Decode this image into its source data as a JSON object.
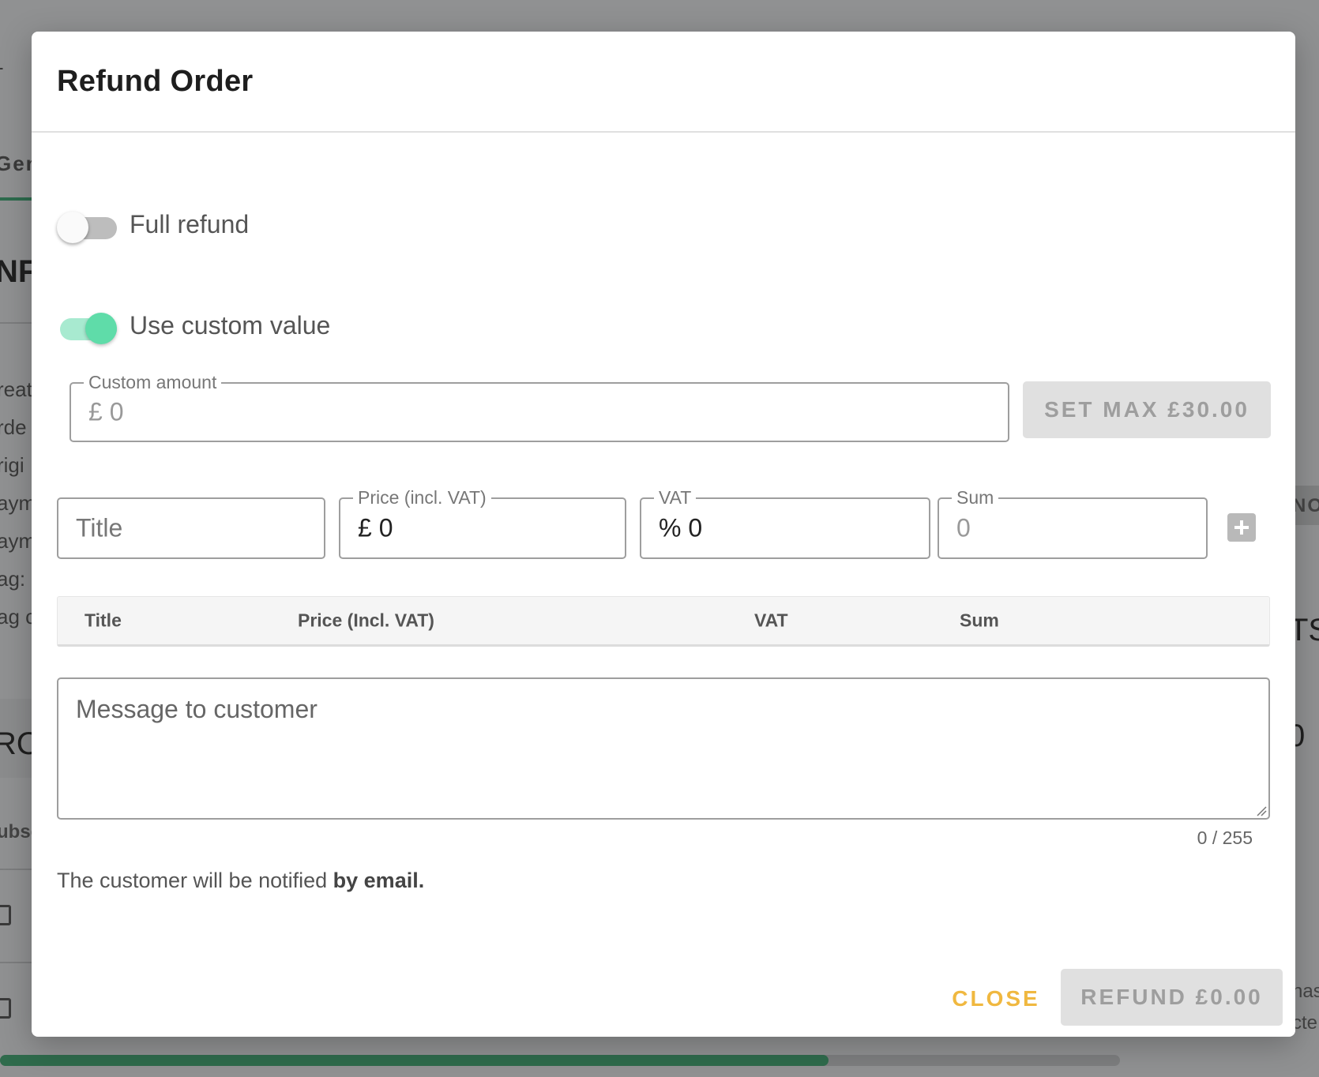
{
  "background": {
    "fragments": {
      "top_dash": "-",
      "tab": "Gen",
      "section_info": "NF",
      "created": "reat",
      "order": "rde",
      "origin": "rigi",
      "payment1": "aym",
      "payment2": "aym",
      "tag": "ag:",
      "tag2": "ag c",
      "section_pro": "RO",
      "subscription": "ubsc",
      "right_chip": "NO",
      "right_ts": "TS",
      "right_zero": "0",
      "right_has": "has",
      "right_cte": "cte"
    },
    "progress_fraction": 0.74
  },
  "dialog": {
    "title": "Refund Order",
    "full_refund": {
      "label": "Full refund",
      "on": false
    },
    "custom_value": {
      "label": "Use custom value",
      "on": true
    },
    "custom_amount": {
      "legend": "Custom amount",
      "value": "£ 0"
    },
    "set_max_button": "SET MAX £30.00",
    "line_item": {
      "title_placeholder": "Title",
      "price_legend": "Price (incl. VAT)",
      "price_value": "£ 0",
      "vat_legend": "VAT",
      "vat_value": "% 0",
      "sum_legend": "Sum",
      "sum_value": "0"
    },
    "table": {
      "headers": [
        "Title",
        "Price (Incl. VAT)",
        "VAT",
        "Sum"
      ]
    },
    "message": {
      "placeholder": "Message to customer",
      "counter": "0 / 255"
    },
    "notify_prefix": "The customer will be notified ",
    "notify_bold": "by email.",
    "close_button": "CLOSE",
    "refund_button": "REFUND £0.00"
  },
  "colors": {
    "accent_green": "#5fdca9",
    "close_yellow": "#f0b840",
    "overlay": "#909192"
  }
}
